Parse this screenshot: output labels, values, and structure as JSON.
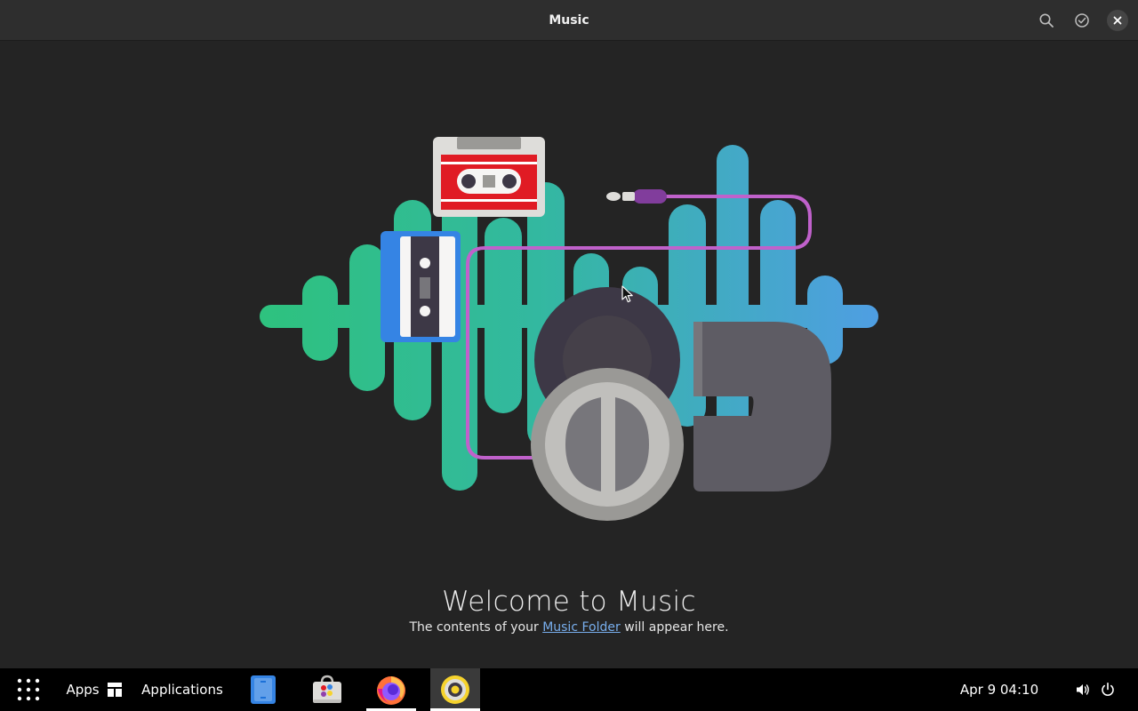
{
  "window": {
    "title": "Music"
  },
  "headerbar": {
    "search_icon": "search-icon",
    "select_icon": "check-circle-icon",
    "close_icon": "close-icon"
  },
  "empty_state": {
    "title": "Welcome to Music",
    "desc_before": "The contents of your ",
    "desc_link": "Music Folder",
    "desc_after": " will appear here."
  },
  "taskbar": {
    "apps_label": "Apps",
    "applications_label": "Applications",
    "clock": "Apr 9  04:10",
    "dock": [
      {
        "name": "Files",
        "icon": "files-icon"
      },
      {
        "name": "Software",
        "icon": "software-store-icon"
      },
      {
        "name": "Firefox",
        "icon": "firefox-icon",
        "running": true
      },
      {
        "name": "Music",
        "icon": "music-app-icon",
        "running": true,
        "focused": true
      }
    ]
  },
  "colors": {
    "background": "#242424",
    "headerbar": "#2e2e2e",
    "taskbar": "#000000",
    "link": "#78aeed",
    "cable": "#c061cb"
  }
}
